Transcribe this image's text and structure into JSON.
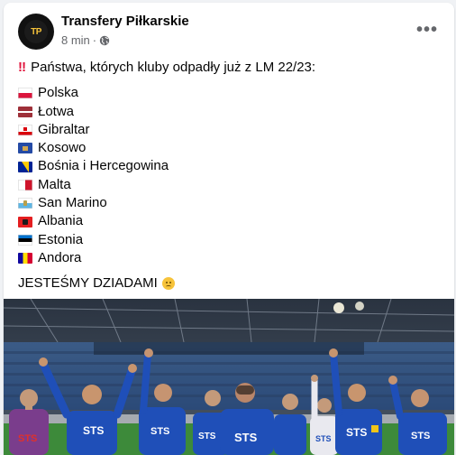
{
  "post": {
    "page_name": "Transfery Piłkarskie",
    "time": "8 min",
    "dot": "·",
    "avatar_text": "TP",
    "more_label": "•••",
    "headline_icon": "double-exclamation-icon",
    "headline": "Państwa, których kluby odpadły już z LM 22/23:",
    "countries": [
      {
        "name": "Polska",
        "flag": "poland-flag-icon"
      },
      {
        "name": "Łotwa",
        "flag": "latvia-flag-icon"
      },
      {
        "name": "Gibraltar",
        "flag": "gibraltar-flag-icon"
      },
      {
        "name": "Kosowo",
        "flag": "kosovo-flag-icon"
      },
      {
        "name": "Bośnia i Hercegowina",
        "flag": "bosnia-flag-icon"
      },
      {
        "name": "Malta",
        "flag": "malta-flag-icon"
      },
      {
        "name": "San Marino",
        "flag": "san-marino-flag-icon"
      },
      {
        "name": "Albania",
        "flag": "albania-flag-icon"
      },
      {
        "name": "Estonia",
        "flag": "estonia-flag-icon"
      },
      {
        "name": "Andora",
        "flag": "andorra-flag-icon"
      }
    ],
    "closing": "JESTEŚMY DZIADAMI",
    "closing_emoji": "frowning-face-icon",
    "shirt_sponsor": "STS"
  },
  "colors": {
    "card_bg": "#ffffff",
    "page_bg": "#f0f2f5",
    "meta_text": "#65676b",
    "alert_red": "#e1173f",
    "team_blue": "#1f4fb8"
  }
}
